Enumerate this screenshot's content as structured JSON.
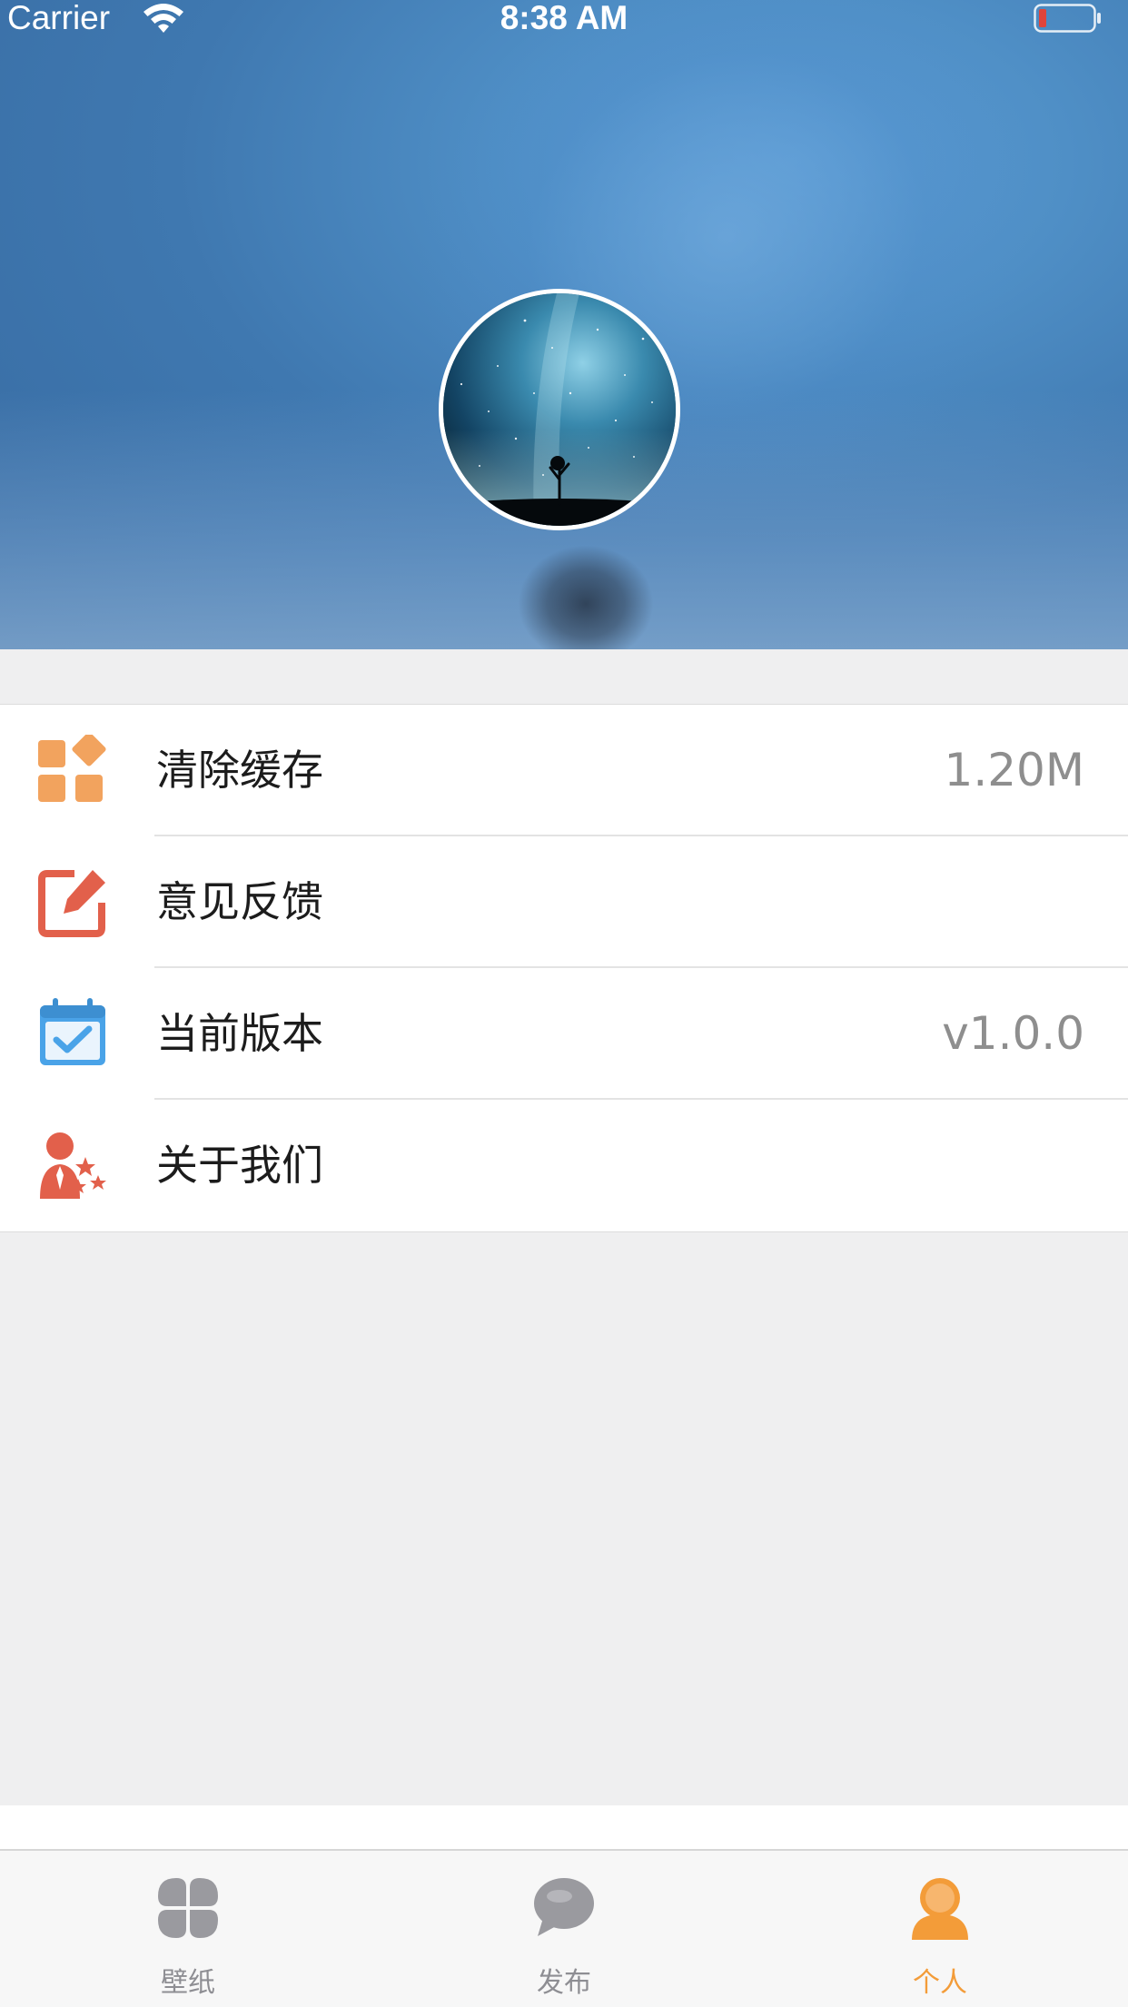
{
  "status_bar": {
    "carrier": "Carrier",
    "time": "8:38 AM",
    "icons": [
      "wifi-icon",
      "battery-icon"
    ],
    "battery_color": "#e0443a"
  },
  "profile": {
    "avatar": "avatar-starry-tree"
  },
  "menu": {
    "items": [
      {
        "label": "清除缓存",
        "value": "1.20M",
        "icon": "grid-blocks-icon",
        "icon_color": "#f2a35e"
      },
      {
        "label": "意见反馈",
        "value": "",
        "icon": "edit-icon",
        "icon_color": "#e2604b"
      },
      {
        "label": "当前版本",
        "value": "v1.0.0",
        "icon": "calendar-check-icon",
        "icon_color": "#4aa3e8"
      },
      {
        "label": "关于我们",
        "value": "",
        "icon": "person-stars-icon",
        "icon_color": "#e2604b"
      }
    ]
  },
  "tab_bar": {
    "tabs": [
      {
        "label": "壁纸",
        "icon": "clover-icon",
        "active": false
      },
      {
        "label": "发布",
        "icon": "chat-bubble-icon",
        "active": false
      },
      {
        "label": "个人",
        "icon": "person-icon",
        "active": true
      }
    ],
    "active_color": "#f39c39",
    "inactive_color": "#8e8e93"
  }
}
